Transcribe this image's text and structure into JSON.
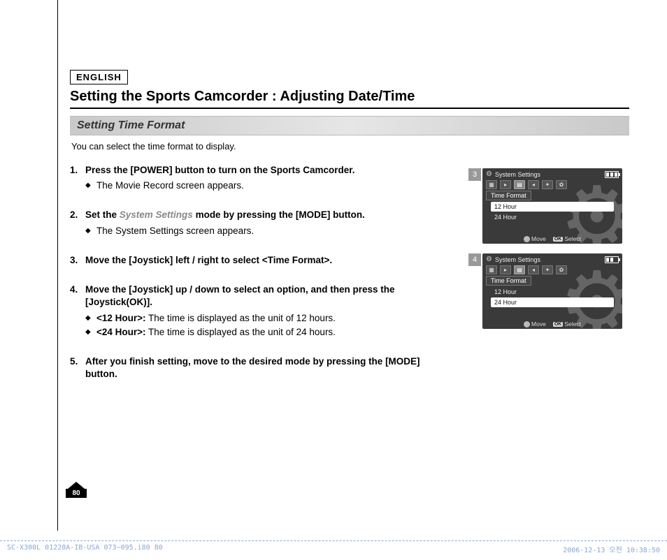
{
  "header": {
    "language_box": "ENGLISH",
    "title": "Setting the Sports Camcorder : Adjusting Date/Time",
    "subtitle": "Setting Time Format",
    "intro": "You can select the time format to display."
  },
  "steps": [
    {
      "title": "Press the [POWER] button to turn on the Sports Camcorder.",
      "bullets": [
        {
          "text": "The Movie Record screen appears."
        }
      ]
    },
    {
      "title_prefix": "Set the ",
      "title_em": "System Settings",
      "title_suffix": " mode by pressing the [MODE] button.",
      "bullets": [
        {
          "text": "The System Settings screen appears."
        }
      ]
    },
    {
      "title": "Move the [Joystick] left / right to select <Time Format>."
    },
    {
      "title": "Move the [Joystick] up / down to select an option, and then press the [Joystick(OK)].",
      "bullets": [
        {
          "bold": "<12 Hour>:",
          "text": " The time is displayed as the unit of 12 hours."
        },
        {
          "bold": "<24 Hour>:",
          "text": " The time is displayed as the unit of 24 hours."
        }
      ]
    },
    {
      "title": "After you finish setting, move to the desired mode by pressing the [MODE] button."
    }
  ],
  "screens": [
    {
      "badge": "3",
      "header": "System Settings",
      "label": "Time Format",
      "options": [
        {
          "text": "12 Hour",
          "selected": true
        },
        {
          "text": "24 Hour",
          "selected": false
        }
      ],
      "footer_move": "Move",
      "footer_select": "Select",
      "footer_ok": "OK"
    },
    {
      "badge": "4",
      "header": "System Settings",
      "label": "Time Format",
      "options": [
        {
          "text": "12 Hour",
          "selected": false
        },
        {
          "text": "24 Hour",
          "selected": true
        }
      ],
      "footer_move": "Move",
      "footer_select": "Select",
      "footer_ok": "OK"
    }
  ],
  "page_number": "80",
  "footer": {
    "left": "SC-X300L 01228A-IB-USA 073~095.i80   80",
    "right": "2006-12-13   오전 10:38:50"
  }
}
